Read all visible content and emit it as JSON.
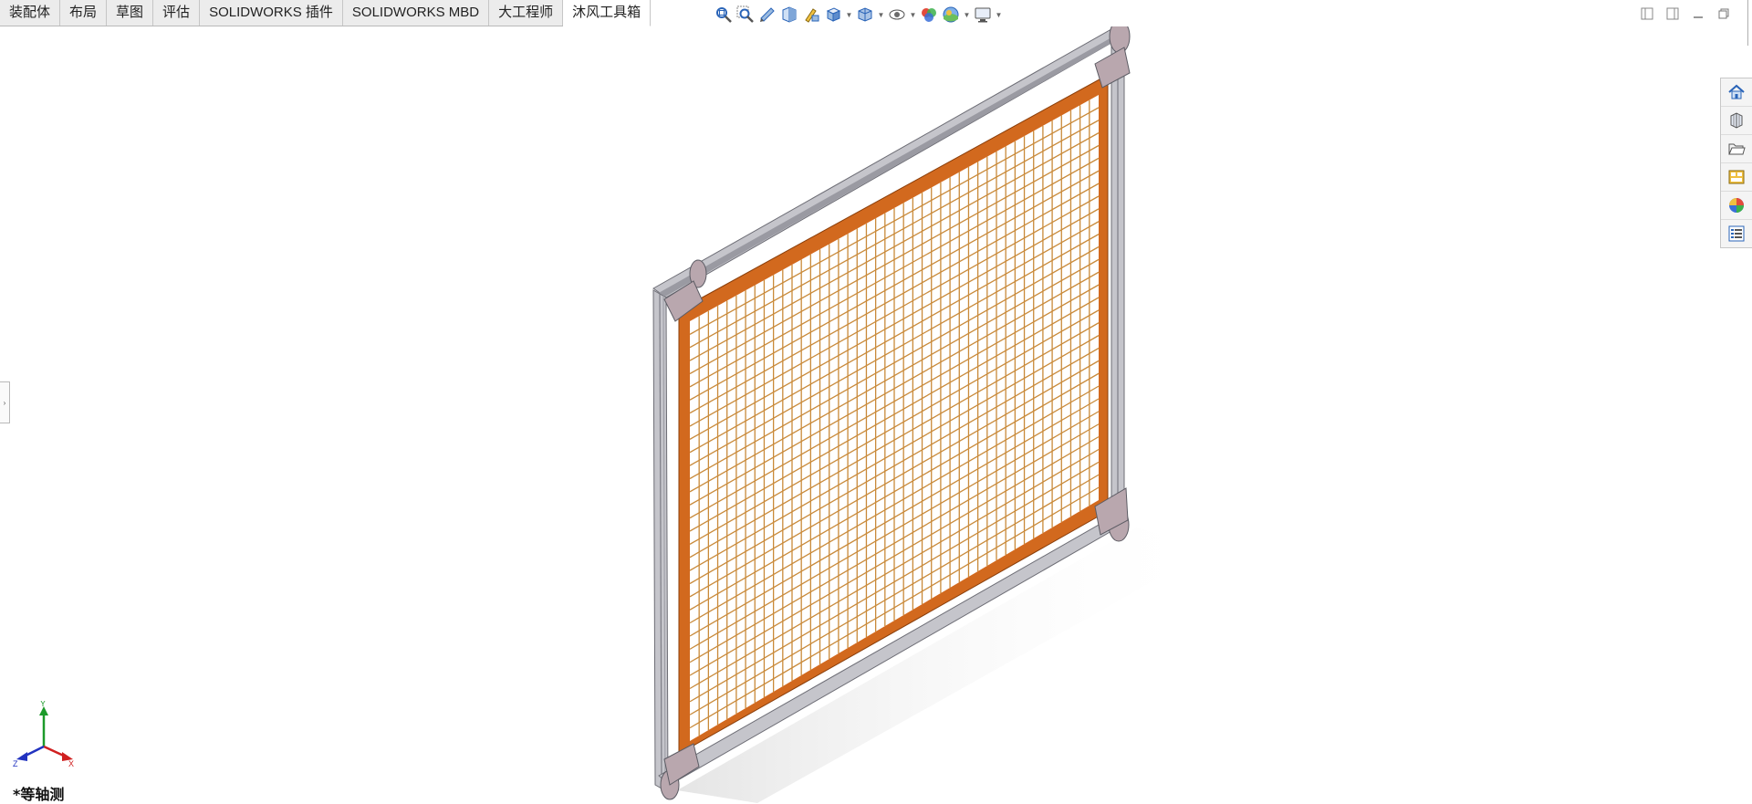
{
  "tabs": [
    {
      "label": "装配体",
      "active": false
    },
    {
      "label": "布局",
      "active": false
    },
    {
      "label": "草图",
      "active": false
    },
    {
      "label": "评估",
      "active": false
    },
    {
      "label": "SOLIDWORKS 插件",
      "active": false
    },
    {
      "label": "SOLIDWORKS MBD",
      "active": false
    },
    {
      "label": "大工程师",
      "active": false
    },
    {
      "label": "沐风工具箱",
      "active": true
    }
  ],
  "view_toolbar_icons": [
    "zoom-to-fit-icon",
    "zoom-to-area-icon",
    "previous-view-icon",
    "section-view-icon",
    "dynamic-annotation-icon",
    "view-orientation-icon",
    "display-style-icon",
    "hide-show-items-icon",
    "edit-appearance-icon",
    "apply-scene-icon",
    "view-settings-icon"
  ],
  "task_pane_icons": [
    "solidworks-resources-icon",
    "design-library-icon",
    "file-explorer-icon",
    "view-palette-icon",
    "appearances-scenes-icon",
    "custom-properties-icon"
  ],
  "colors": {
    "frame_orange": "#d2691e",
    "frame_orange_dark": "#a54e10",
    "mesh": "#c98a3a",
    "aluminum": "#b9b9bf",
    "aluminum_dark": "#7d7d86",
    "triad_x": "#d02020",
    "triad_y": "#1c9a2a",
    "triad_z": "#2233c0"
  },
  "triad": {
    "x_label": "X",
    "y_label": "Y",
    "z_label": "Z"
  },
  "view_name": "*等轴测"
}
